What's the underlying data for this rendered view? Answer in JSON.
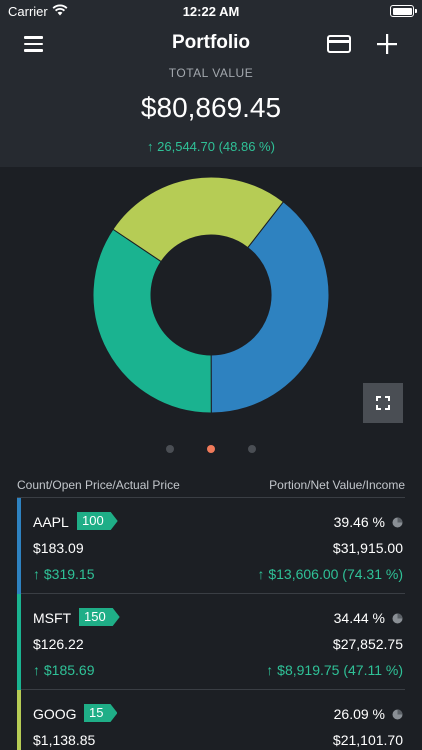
{
  "status": {
    "carrier": "Carrier",
    "time": "12:22 AM"
  },
  "nav": {
    "title": "Portfolio"
  },
  "summary": {
    "label": "TOTAL VALUE",
    "value": "$80,869.45",
    "change": "↑ 26,544.70 (48.86 %)"
  },
  "colors": {
    "accent": "#2fc197",
    "tag": "#1fae87",
    "aapl": "#2e82c0",
    "msft": "#1ab390",
    "goog": "#b6cc55"
  },
  "chart_data": {
    "type": "pie",
    "donut": true,
    "categories": [
      "AAPL",
      "MSFT",
      "GOOG"
    ],
    "values": [
      39.46,
      34.44,
      26.09
    ],
    "colors": [
      "#2e82c0",
      "#1ab390",
      "#b6cc55"
    ]
  },
  "pager": {
    "count": 3,
    "active": 1
  },
  "list": {
    "header_left": "Count/Open Price/Actual Price",
    "header_right": "Portion/Net Value/Income",
    "rows": [
      {
        "symbol": "AAPL",
        "count": "100",
        "portion": "39.46 %",
        "open_price": "$183.09",
        "net_value": "$31,915.00",
        "price_change": "↑ $319.15",
        "income": "↑ $13,606.00 (74.31 %)"
      },
      {
        "symbol": "MSFT",
        "count": "150",
        "portion": "34.44 %",
        "open_price": "$126.22",
        "net_value": "$27,852.75",
        "price_change": "↑ $185.69",
        "income": "↑ $8,919.75 (47.11 %)"
      },
      {
        "symbol": "GOOG",
        "count": "15",
        "portion": "26.09 %",
        "open_price": "$1,138.85",
        "net_value": "$21,101.70",
        "price_change": "",
        "income": ""
      }
    ]
  }
}
